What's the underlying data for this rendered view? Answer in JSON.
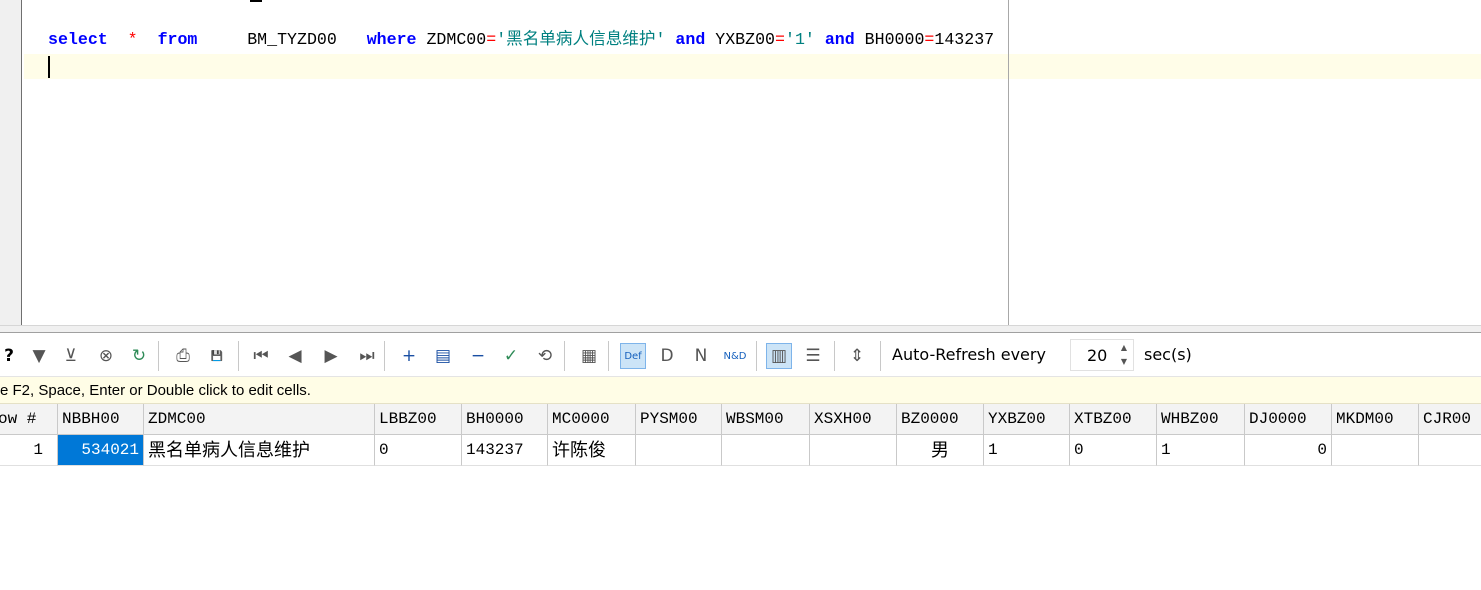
{
  "editor": {
    "sql_tokens": [
      {
        "text": "select",
        "cls": "kw"
      },
      {
        "text": "  ",
        "cls": "ident"
      },
      {
        "text": "*",
        "cls": "op"
      },
      {
        "text": "  ",
        "cls": "ident"
      },
      {
        "text": "from",
        "cls": "kw"
      },
      {
        "text": "     BM_TYZD00   ",
        "cls": "ident"
      },
      {
        "text": "where",
        "cls": "kw"
      },
      {
        "text": " ZDMC00",
        "cls": "ident"
      },
      {
        "text": "=",
        "cls": "op"
      },
      {
        "text": "'黑名单病人信息维护'",
        "cls": "str"
      },
      {
        "text": " ",
        "cls": "ident"
      },
      {
        "text": "and",
        "cls": "kw"
      },
      {
        "text": " YXBZ00",
        "cls": "ident"
      },
      {
        "text": "=",
        "cls": "op"
      },
      {
        "text": "'1'",
        "cls": "str"
      },
      {
        "text": " ",
        "cls": "ident"
      },
      {
        "text": "and",
        "cls": "kw"
      },
      {
        "text": " BH0000",
        "cls": "ident"
      },
      {
        "text": "=",
        "cls": "op"
      },
      {
        "text": "143237",
        "cls": "ident"
      }
    ]
  },
  "toolbar": {
    "buttons": [
      {
        "name": "query-help-icon",
        "glyph": "?",
        "active": false
      },
      {
        "name": "filter-icon",
        "glyph": "▼",
        "active": false
      },
      {
        "name": "clear-filter-icon",
        "glyph": "⊻",
        "active": false
      },
      {
        "name": "cancel-icon",
        "glyph": "⊗",
        "active": false
      },
      {
        "name": "refresh-icon",
        "glyph": "↻",
        "active": false
      },
      {
        "name": "print-icon",
        "glyph": "⎙",
        "active": false
      },
      {
        "name": "save-icon",
        "glyph": "💾",
        "active": false
      },
      {
        "name": "first-record-icon",
        "glyph": "⏮",
        "active": false
      },
      {
        "name": "previous-record-icon",
        "glyph": "◀",
        "active": false
      },
      {
        "name": "next-record-icon",
        "glyph": "▶",
        "active": false
      },
      {
        "name": "last-record-icon",
        "glyph": "⏭",
        "active": false
      },
      {
        "name": "insert-record-icon",
        "glyph": "+",
        "active": false
      },
      {
        "name": "duplicate-record-icon",
        "glyph": "▤",
        "active": false
      },
      {
        "name": "delete-record-icon",
        "glyph": "−",
        "active": false
      },
      {
        "name": "post-changes-icon",
        "glyph": "✓",
        "active": false
      },
      {
        "name": "cancel-changes-icon",
        "glyph": "⟲",
        "active": false
      },
      {
        "name": "single-record-view-icon",
        "glyph": "▦",
        "active": false
      },
      {
        "name": "default-view-icon",
        "glyph": "Def",
        "active": true
      },
      {
        "name": "view-d-icon",
        "glyph": "D",
        "active": false
      },
      {
        "name": "view-n-icon",
        "glyph": "N",
        "active": false
      },
      {
        "name": "view-nd-icon",
        "glyph": "N&D",
        "active": false
      },
      {
        "name": "grid-view-icon",
        "glyph": "▥",
        "active": true
      },
      {
        "name": "text-view-icon",
        "glyph": "☰",
        "active": false
      },
      {
        "name": "row-height-icon",
        "glyph": "⇕",
        "active": false
      }
    ],
    "auto_refresh_label": "Auto-Refresh every",
    "refresh_value": "20",
    "sec_label": "sec(s)"
  },
  "hint": {
    "text": "e F2, Space, Enter or Double click to edit cells."
  },
  "grid": {
    "columns": [
      "ow #",
      "NBBH00",
      "ZDMC00",
      "LBBZ00",
      "BH0000",
      "MC0000",
      "PYSM00",
      "WBSM00",
      "XSXH00",
      "BZ0000",
      "YXBZ00",
      "XTBZ00",
      "WHBZ00",
      "DJ0000",
      "MKDM00",
      "CJR00"
    ],
    "rows": [
      [
        "1",
        "534021",
        "黑名单病人信息维护",
        "0",
        "143237",
        "许陈俊",
        "",
        "",
        "",
        "男",
        "1",
        "0",
        "1",
        "0",
        "",
        ""
      ]
    ]
  }
}
